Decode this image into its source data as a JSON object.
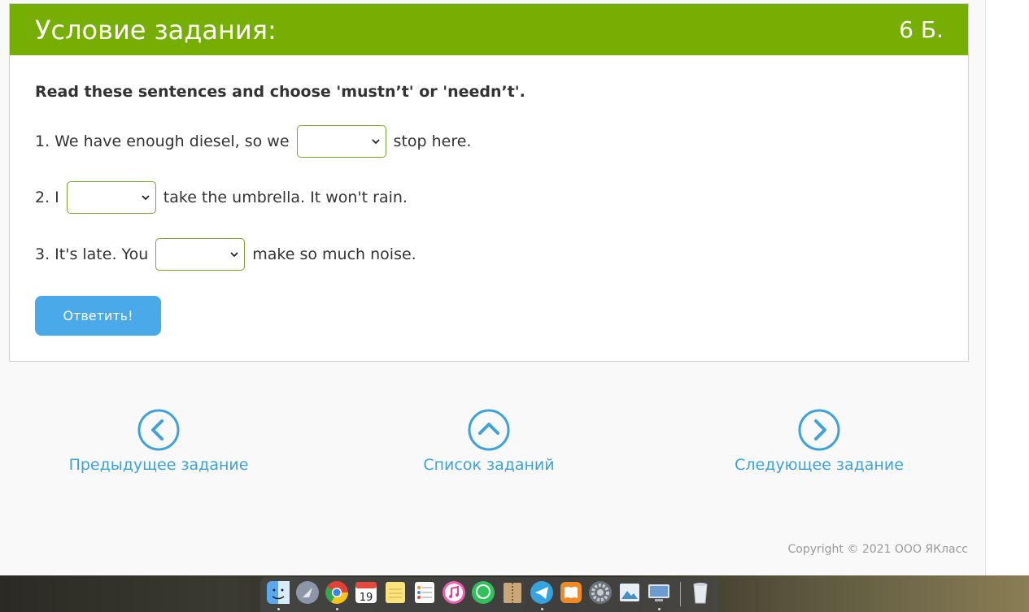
{
  "header": {
    "title": "Условие задания:",
    "points": "6 Б."
  },
  "instruction": "Read these sentences and choose 'mustn’t' or 'needn’t'.",
  "sentences": [
    {
      "before": "1. We have enough diesel, so we",
      "after": "stop here.",
      "selected": ""
    },
    {
      "before": "2. I",
      "after": "take the umbrella. It won't rain.",
      "selected": ""
    },
    {
      "before": "3. It's late. You",
      "after": "make so much noise.",
      "selected": ""
    }
  ],
  "submit_label": "Ответить!",
  "nav": {
    "prev": "Предыдущее задание",
    "list": "Список заданий",
    "next": "Следующее задание"
  },
  "copyright": "Copyright © 2021 ООО ЯКласс",
  "colors": {
    "header": "#76ae03",
    "button": "#4aa9e8",
    "link": "#3ea2d8"
  },
  "dock": {
    "calendar_day": "19",
    "apps": [
      "finder-icon",
      "launchpad-icon",
      "chrome-icon",
      "calendar-icon",
      "notes-icon",
      "reminders-icon",
      "itunes-icon",
      "whatsapp-icon",
      "archive-icon",
      "telegram-icon",
      "books-icon",
      "system-preferences-icon",
      "preview-icon",
      "screen-sharing-icon",
      "trash-icon"
    ]
  }
}
